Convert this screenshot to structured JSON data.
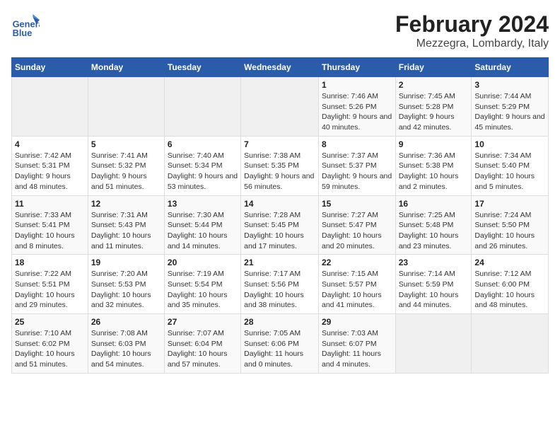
{
  "header": {
    "logo_text_general": "General",
    "logo_text_blue": "Blue",
    "title": "February 2024",
    "subtitle": "Mezzegra, Lombardy, Italy"
  },
  "columns": [
    "Sunday",
    "Monday",
    "Tuesday",
    "Wednesday",
    "Thursday",
    "Friday",
    "Saturday"
  ],
  "rows": [
    [
      {
        "day": "",
        "empty": true
      },
      {
        "day": "",
        "empty": true
      },
      {
        "day": "",
        "empty": true
      },
      {
        "day": "",
        "empty": true
      },
      {
        "day": "1",
        "sunrise": "7:46 AM",
        "sunset": "5:26 PM",
        "daylight": "9 hours and 40 minutes."
      },
      {
        "day": "2",
        "sunrise": "7:45 AM",
        "sunset": "5:28 PM",
        "daylight": "9 hours and 42 minutes."
      },
      {
        "day": "3",
        "sunrise": "7:44 AM",
        "sunset": "5:29 PM",
        "daylight": "9 hours and 45 minutes."
      }
    ],
    [
      {
        "day": "4",
        "sunrise": "7:42 AM",
        "sunset": "5:31 PM",
        "daylight": "9 hours and 48 minutes."
      },
      {
        "day": "5",
        "sunrise": "7:41 AM",
        "sunset": "5:32 PM",
        "daylight": "9 hours and 51 minutes."
      },
      {
        "day": "6",
        "sunrise": "7:40 AM",
        "sunset": "5:34 PM",
        "daylight": "9 hours and 53 minutes."
      },
      {
        "day": "7",
        "sunrise": "7:38 AM",
        "sunset": "5:35 PM",
        "daylight": "9 hours and 56 minutes."
      },
      {
        "day": "8",
        "sunrise": "7:37 AM",
        "sunset": "5:37 PM",
        "daylight": "9 hours and 59 minutes."
      },
      {
        "day": "9",
        "sunrise": "7:36 AM",
        "sunset": "5:38 PM",
        "daylight": "10 hours and 2 minutes."
      },
      {
        "day": "10",
        "sunrise": "7:34 AM",
        "sunset": "5:40 PM",
        "daylight": "10 hours and 5 minutes."
      }
    ],
    [
      {
        "day": "11",
        "sunrise": "7:33 AM",
        "sunset": "5:41 PM",
        "daylight": "10 hours and 8 minutes."
      },
      {
        "day": "12",
        "sunrise": "7:31 AM",
        "sunset": "5:43 PM",
        "daylight": "10 hours and 11 minutes."
      },
      {
        "day": "13",
        "sunrise": "7:30 AM",
        "sunset": "5:44 PM",
        "daylight": "10 hours and 14 minutes."
      },
      {
        "day": "14",
        "sunrise": "7:28 AM",
        "sunset": "5:45 PM",
        "daylight": "10 hours and 17 minutes."
      },
      {
        "day": "15",
        "sunrise": "7:27 AM",
        "sunset": "5:47 PM",
        "daylight": "10 hours and 20 minutes."
      },
      {
        "day": "16",
        "sunrise": "7:25 AM",
        "sunset": "5:48 PM",
        "daylight": "10 hours and 23 minutes."
      },
      {
        "day": "17",
        "sunrise": "7:24 AM",
        "sunset": "5:50 PM",
        "daylight": "10 hours and 26 minutes."
      }
    ],
    [
      {
        "day": "18",
        "sunrise": "7:22 AM",
        "sunset": "5:51 PM",
        "daylight": "10 hours and 29 minutes."
      },
      {
        "day": "19",
        "sunrise": "7:20 AM",
        "sunset": "5:53 PM",
        "daylight": "10 hours and 32 minutes."
      },
      {
        "day": "20",
        "sunrise": "7:19 AM",
        "sunset": "5:54 PM",
        "daylight": "10 hours and 35 minutes."
      },
      {
        "day": "21",
        "sunrise": "7:17 AM",
        "sunset": "5:56 PM",
        "daylight": "10 hours and 38 minutes."
      },
      {
        "day": "22",
        "sunrise": "7:15 AM",
        "sunset": "5:57 PM",
        "daylight": "10 hours and 41 minutes."
      },
      {
        "day": "23",
        "sunrise": "7:14 AM",
        "sunset": "5:59 PM",
        "daylight": "10 hours and 44 minutes."
      },
      {
        "day": "24",
        "sunrise": "7:12 AM",
        "sunset": "6:00 PM",
        "daylight": "10 hours and 48 minutes."
      }
    ],
    [
      {
        "day": "25",
        "sunrise": "7:10 AM",
        "sunset": "6:02 PM",
        "daylight": "10 hours and 51 minutes."
      },
      {
        "day": "26",
        "sunrise": "7:08 AM",
        "sunset": "6:03 PM",
        "daylight": "10 hours and 54 minutes."
      },
      {
        "day": "27",
        "sunrise": "7:07 AM",
        "sunset": "6:04 PM",
        "daylight": "10 hours and 57 minutes."
      },
      {
        "day": "28",
        "sunrise": "7:05 AM",
        "sunset": "6:06 PM",
        "daylight": "11 hours and 0 minutes."
      },
      {
        "day": "29",
        "sunrise": "7:03 AM",
        "sunset": "6:07 PM",
        "daylight": "11 hours and 4 minutes."
      },
      {
        "day": "",
        "empty": true
      },
      {
        "day": "",
        "empty": true
      }
    ]
  ],
  "labels": {
    "sunrise": "Sunrise:",
    "sunset": "Sunset:",
    "daylight": "Daylight:"
  }
}
